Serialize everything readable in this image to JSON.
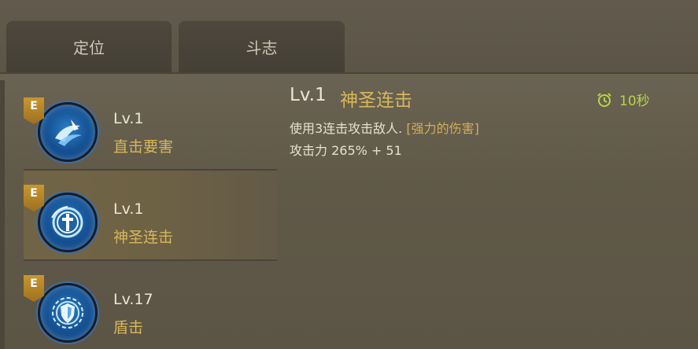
{
  "tabs": [
    {
      "label": "定位"
    },
    {
      "label": "斗志"
    }
  ],
  "skills": [
    {
      "badge": "E",
      "level": "Lv.1",
      "name": "直击要害",
      "icon": "slash-icon",
      "selected": false
    },
    {
      "badge": "E",
      "level": "Lv.1",
      "name": "神圣连击",
      "icon": "holy-sword-icon",
      "selected": true
    },
    {
      "badge": "E",
      "level": "Lv.17",
      "name": "盾击",
      "icon": "shield-icon",
      "selected": false
    }
  ],
  "detail": {
    "level": "Lv.1",
    "name": "神圣连击",
    "description": "使用3连击攻击敌人.",
    "tag": "[强力的伤害]",
    "damage": "攻击力 265% + 51",
    "cooldown": "10秒",
    "cooldown_icon": "alarm-clock-icon"
  },
  "colors": {
    "gold": "#d7b75c",
    "cooldown": "#b7d54a",
    "badge": "#c8972e"
  }
}
